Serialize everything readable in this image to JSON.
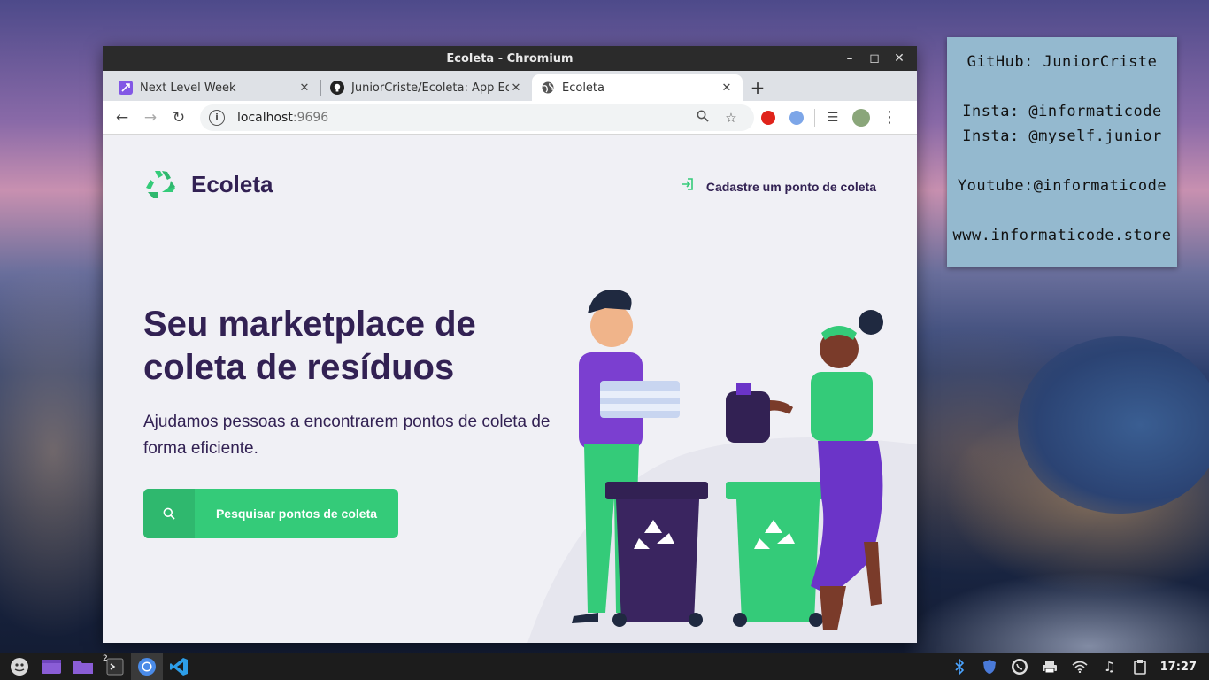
{
  "window": {
    "title": "Ecoleta - Chromium"
  },
  "tabs": [
    {
      "label": "Next Level Week",
      "favicon": "nlw-icon",
      "color": "#8257e5"
    },
    {
      "label": "JuniorCriste/Ecoleta: App Eco",
      "favicon": "github-icon",
      "color": "#222222"
    },
    {
      "label": "Ecoleta",
      "favicon": "globe-icon",
      "active": true
    }
  ],
  "address_bar": {
    "host": "localhost",
    "port": ":9696"
  },
  "page": {
    "logo_text": "Ecoleta",
    "register_link": "Cadastre um ponto de coleta",
    "hero_title": "Seu marketplace de coleta de resíduos",
    "hero_subtitle": "Ajudamos pessoas a encontrarem pontos de coleta de forma eficiente.",
    "search_button": "Pesquisar pontos de coleta",
    "colors": {
      "primary": "#34cb79",
      "title": "#322153",
      "background": "#f0f0f5"
    }
  },
  "note": {
    "lines": [
      "GitHub: JuniorCriste",
      "Insta: @informaticode",
      "Insta: @myself.junior",
      "Youtube:@informaticode",
      "www.informaticode.store"
    ]
  },
  "taskbar": {
    "workspace_badge": "2",
    "clock": "17:27"
  }
}
